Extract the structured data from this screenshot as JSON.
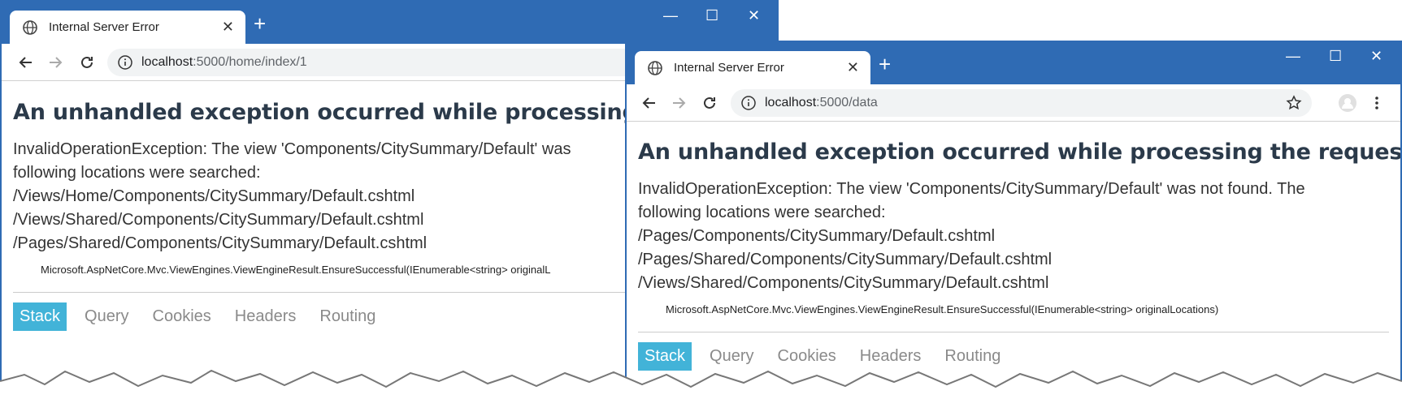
{
  "window_left": {
    "tab_title": "Internal Server Error",
    "new_tab": "+",
    "url_host": "localhost",
    "url_rest": ":5000/home/index/1",
    "heading": "An unhandled exception occurred while processing t",
    "message": [
      "InvalidOperationException: The view 'Components/CitySummary/Default' was",
      "following locations were searched:",
      "/Views/Home/Components/CitySummary/Default.cshtml",
      "/Views/Shared/Components/CitySummary/Default.cshtml",
      "/Pages/Shared/Components/CitySummary/Default.cshtml"
    ],
    "trace": "Microsoft.AspNetCore.Mvc.ViewEngines.ViewEngineResult.EnsureSuccessful(IEnumerable<string> originalL",
    "tabs": [
      "Stack",
      "Query",
      "Cookies",
      "Headers",
      "Routing"
    ]
  },
  "window_right": {
    "tab_title": "Internal Server Error",
    "new_tab": "+",
    "url_host": "localhost",
    "url_rest": ":5000/data",
    "heading": "An unhandled exception occurred while processing the request.",
    "message": [
      "InvalidOperationException: The view 'Components/CitySummary/Default' was not found. The",
      "following locations were searched:",
      "/Pages/Components/CitySummary/Default.cshtml",
      "/Pages/Shared/Components/CitySummary/Default.cshtml",
      "/Views/Shared/Components/CitySummary/Default.cshtml"
    ],
    "trace": "Microsoft.AspNetCore.Mvc.ViewEngines.ViewEngineResult.EnsureSuccessful(IEnumerable<string> originalLocations)",
    "tabs": [
      "Stack",
      "Query",
      "Cookies",
      "Headers",
      "Routing"
    ]
  },
  "window_controls": {
    "minimize": "—",
    "maximize": "☐",
    "close": "✕"
  },
  "icons": [
    "globe-icon",
    "tab-close-icon",
    "back-arrow-icon",
    "forward-arrow-icon",
    "reload-icon",
    "info-icon",
    "star-icon",
    "profile-icon",
    "menu-icon"
  ],
  "colors": {
    "titlebar": "#2f6bb4",
    "active_tab": "#42b3d8",
    "heading": "#2b3a4a"
  }
}
